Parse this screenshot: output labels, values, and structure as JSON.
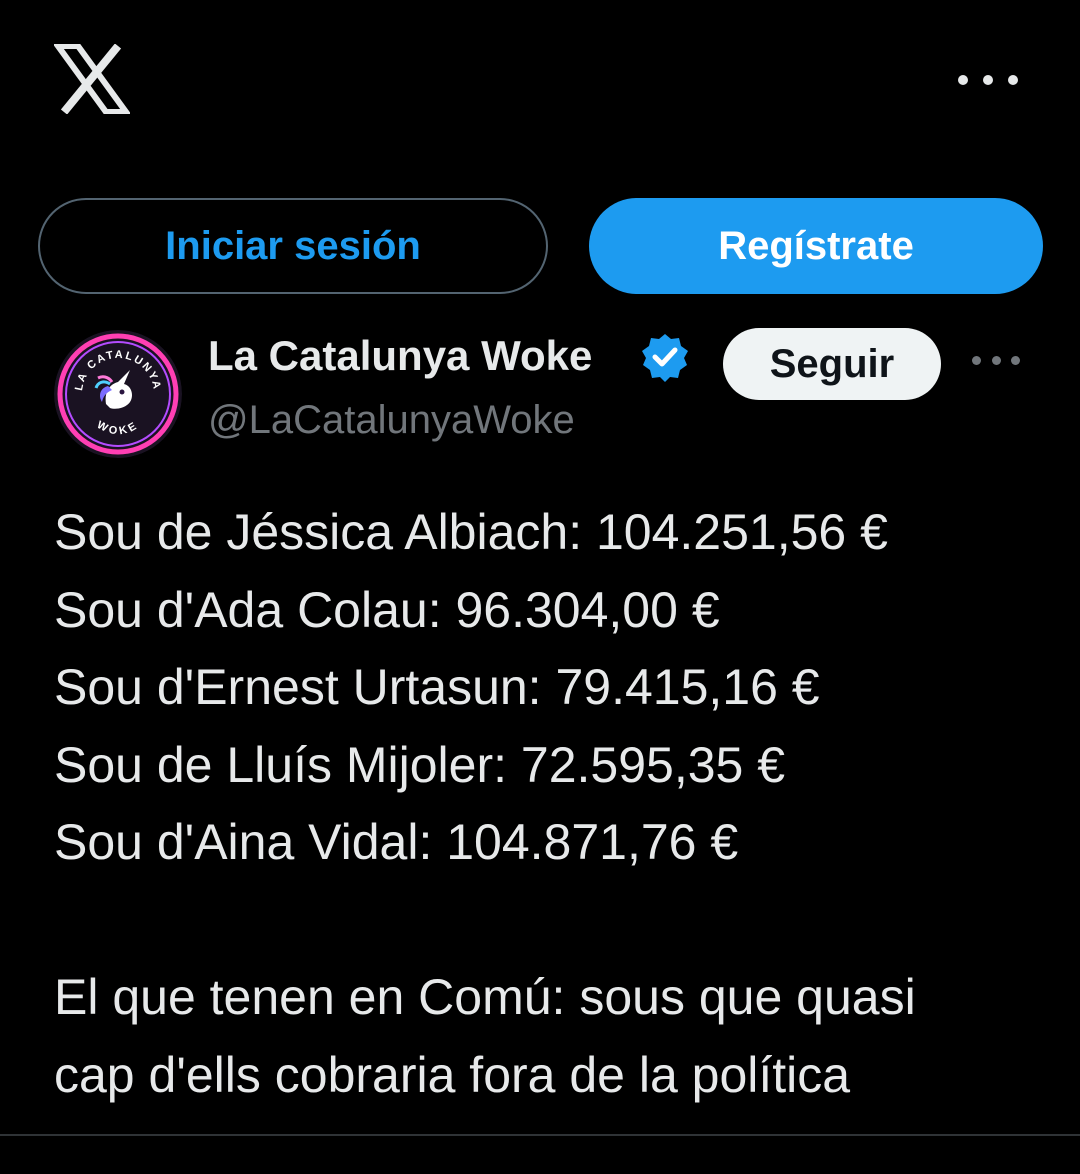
{
  "header": {
    "logo_icon": "x-logo-icon",
    "more_icon": "more-horizontal-icon"
  },
  "auth": {
    "login_label": "Iniciar sesión",
    "signup_label": "Regístrate"
  },
  "tweet": {
    "author_name": "La Catalunya Woke",
    "verified_icon": "verified-badge-icon",
    "handle": "@LaCatalunyaWoke",
    "follow_label": "Seguir",
    "more_icon": "more-horizontal-icon",
    "avatar": {
      "top_text": "LA CATALUNYA",
      "bottom_text": "WOKE"
    },
    "salary_lines": [
      "Sou de Jéssica Albiach: 104.251,56 €",
      "Sou d'Ada Colau: 96.304,00 €",
      "Sou d'Ernest Urtasun: 79.415,16 €",
      "Sou de Lluís Mijoler: 72.595,35 €",
      "Sou d'Aina Vidal: 104.871,76 €"
    ],
    "closing_lines": [
      "El que tenen en Comú: sous que quasi",
      "cap d'ells cobraria fora de la política"
    ]
  },
  "colors": {
    "background": "#000000",
    "accent": "#1d9bf0",
    "text": "#e7e9ea",
    "muted": "#71767b"
  }
}
